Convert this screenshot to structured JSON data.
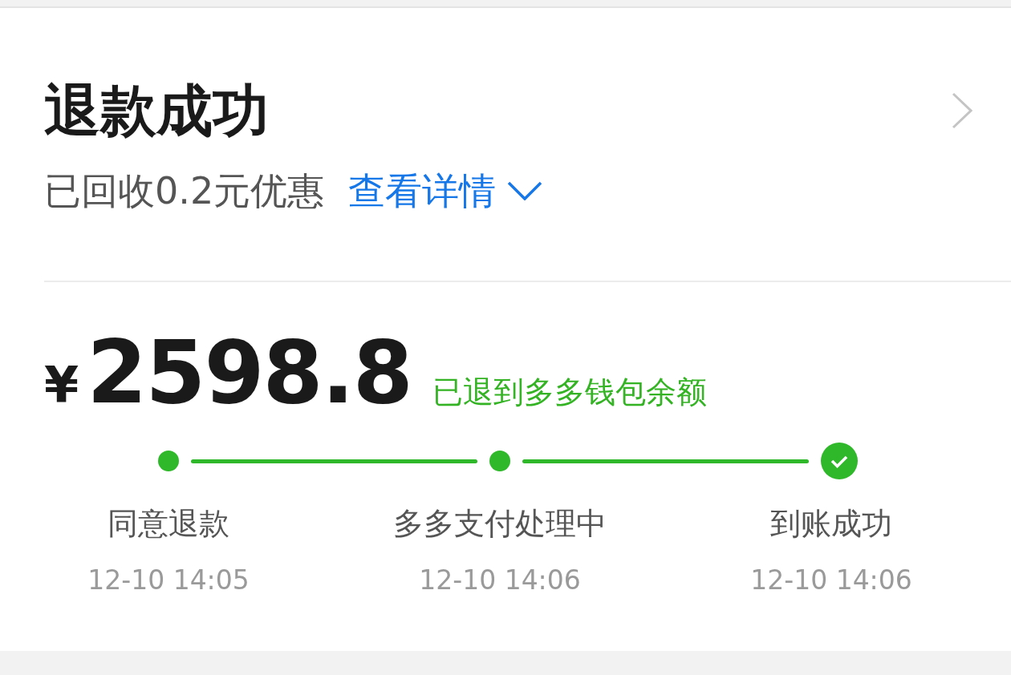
{
  "status": {
    "title": "退款成功",
    "subtitle": "已回收0.2元优惠",
    "link": "查看详情"
  },
  "amount": {
    "currency": "¥",
    "value": "2598.8",
    "note": "已退到多多钱包余额"
  },
  "steps": [
    {
      "kind": "dot",
      "label": "同意退款",
      "time": "12-10 14:05"
    },
    {
      "kind": "dot",
      "label": "多多支付处理中",
      "time": "12-10 14:06"
    },
    {
      "kind": "check",
      "label": "到账成功",
      "time": "12-10 14:06"
    }
  ]
}
